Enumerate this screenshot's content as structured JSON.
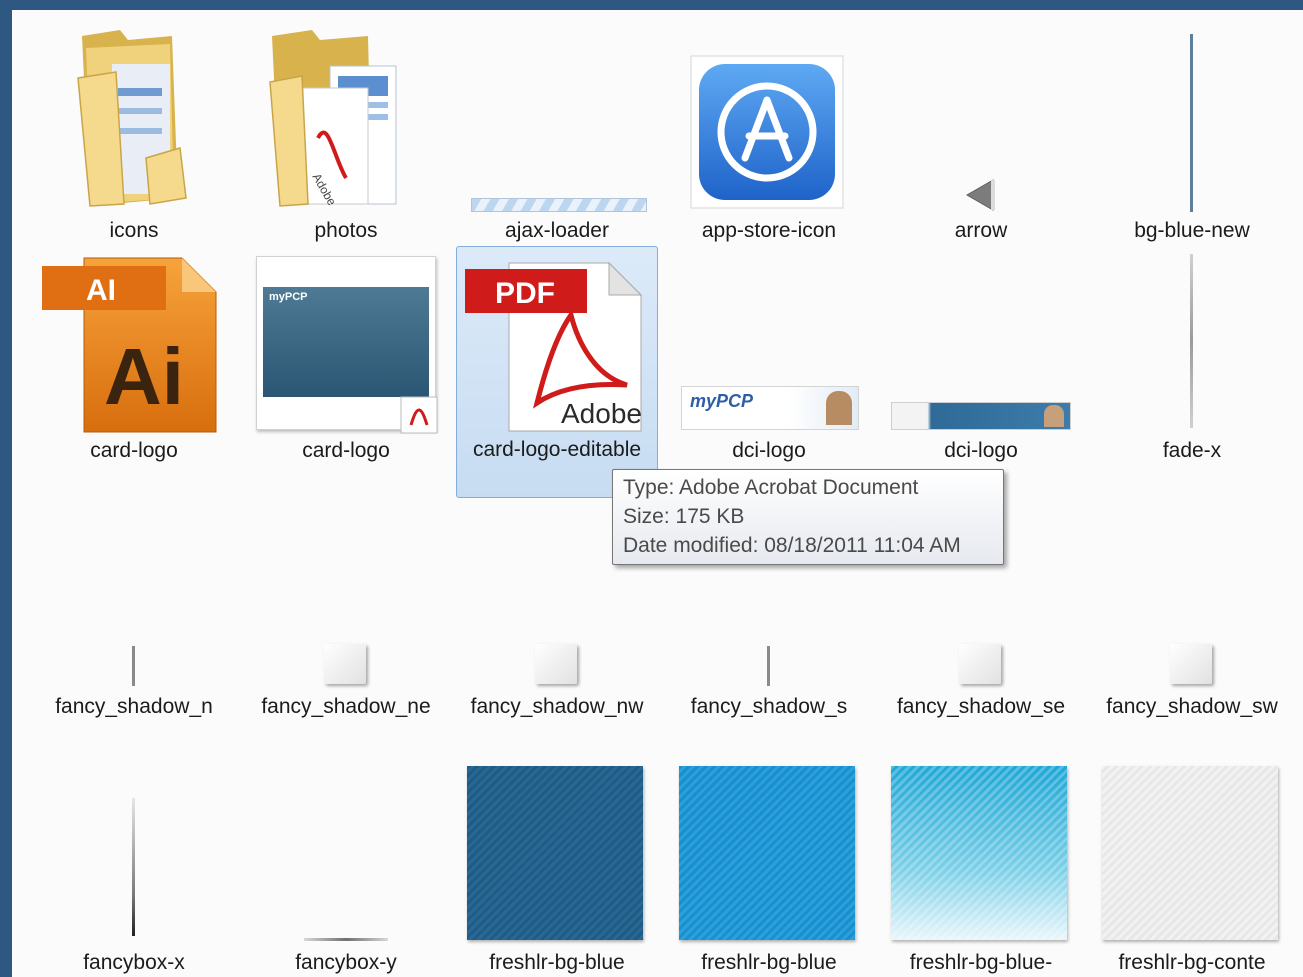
{
  "items": [
    {
      "name": "icons"
    },
    {
      "name": "photos"
    },
    {
      "name": "ajax-loader"
    },
    {
      "name": "app-store-icon"
    },
    {
      "name": "arrow"
    },
    {
      "name": "bg-blue-new"
    },
    {
      "name": "card-logo"
    },
    {
      "name": "card-logo"
    },
    {
      "name": "card-logo-editable"
    },
    {
      "name": "dci-logo"
    },
    {
      "name": "dci-logo"
    },
    {
      "name": "fade-x"
    },
    {
      "name": "fancy_shadow_n"
    },
    {
      "name": "fancy_shadow_ne"
    },
    {
      "name": "fancy_shadow_nw"
    },
    {
      "name": "fancy_shadow_s"
    },
    {
      "name": "fancy_shadow_se"
    },
    {
      "name": "fancy_shadow_sw"
    },
    {
      "name": "fancybox-x"
    },
    {
      "name": "fancybox-y"
    },
    {
      "name": "freshlr-bg-blue"
    },
    {
      "name": "freshlr-bg-blue"
    },
    {
      "name": "freshlr-bg-blue-"
    },
    {
      "name": "freshlr-bg-conte"
    }
  ],
  "thumb_text": {
    "ai_badge": "AI",
    "ai_letters": "Ai",
    "pdf_badge": "PDF",
    "adobe": "Adobe",
    "adobe_folder": "Adobe",
    "mypcp": "myPCP"
  },
  "tooltip": {
    "type": "Type: Adobe Acrobat Document",
    "size": "Size: 175 KB",
    "modified": "Date modified: 08/18/2011 11:04 AM"
  },
  "colors": {
    "frame": "#2e5882",
    "pane": "#fbfbfb",
    "selection": "#c7dcf2",
    "pdf_red": "#d01b1b",
    "ai_orange": "#ef8a1e"
  }
}
